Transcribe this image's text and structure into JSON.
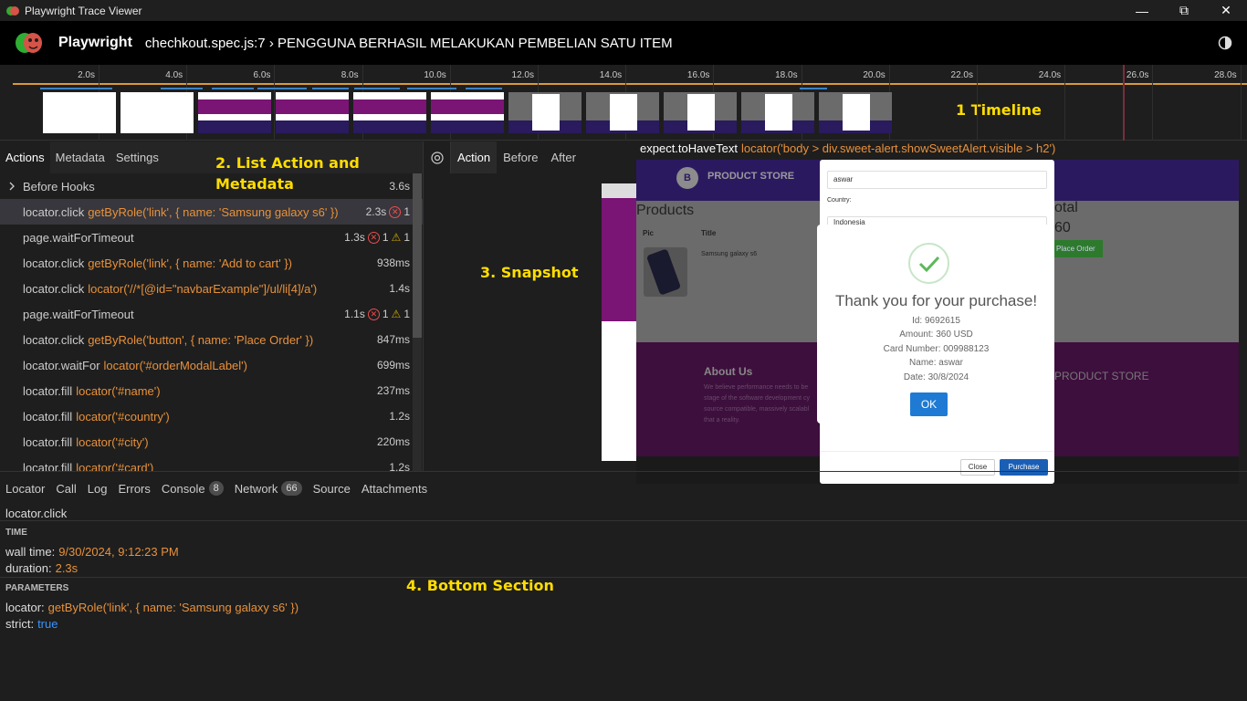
{
  "window": {
    "title": "Playwright Trace Viewer"
  },
  "header": {
    "brand": "Playwright",
    "path": "chechkout.spec.js:7 › PENGGUNA BERHASIL MELAKUKAN PEMBELIAN SATU ITEM"
  },
  "timeline": {
    "ticks": [
      "2.0s",
      "4.0s",
      "6.0s",
      "8.0s",
      "10.0s",
      "12.0s",
      "14.0s",
      "16.0s",
      "18.0s",
      "20.0s",
      "22.0s",
      "24.0s",
      "26.0s",
      "28.0s"
    ]
  },
  "annotations": {
    "timeline": "1 Timeline",
    "list": "2. List Action and Metadata",
    "snapshot": "3. Snapshot",
    "bottom": "4. Bottom Section"
  },
  "left_tabs": [
    "Actions",
    "Metadata",
    "Settings"
  ],
  "actions": [
    {
      "method": "Before Hooks",
      "selector": "",
      "duration": "3.6s",
      "errors": "",
      "warnings": ""
    },
    {
      "method": "locator.click",
      "selector": "getByRole('link', { name: 'Samsung galaxy s6' })",
      "duration": "2.3s",
      "errors": "1",
      "warnings": ""
    },
    {
      "method": "page.waitForTimeout",
      "selector": "",
      "duration": "1.3s",
      "errors": "1",
      "warnings": "1"
    },
    {
      "method": "locator.click",
      "selector": "getByRole('link', { name: 'Add to cart' })",
      "duration": "938ms",
      "errors": "",
      "warnings": ""
    },
    {
      "method": "locator.click",
      "selector": "locator('//*[@id=\"navbarExample\"]/ul/li[4]/a')",
      "duration": "1.4s",
      "errors": "",
      "warnings": ""
    },
    {
      "method": "page.waitForTimeout",
      "selector": "",
      "duration": "1.1s",
      "errors": "1",
      "warnings": "1"
    },
    {
      "method": "locator.click",
      "selector": "getByRole('button', { name: 'Place Order' })",
      "duration": "847ms",
      "errors": "",
      "warnings": ""
    },
    {
      "method": "locator.waitFor",
      "selector": "locator('#orderModalLabel')",
      "duration": "699ms",
      "errors": "",
      "warnings": ""
    },
    {
      "method": "locator.fill",
      "selector": "locator('#name')",
      "duration": "237ms",
      "errors": "",
      "warnings": ""
    },
    {
      "method": "locator.fill",
      "selector": "locator('#country')",
      "duration": "1.2s",
      "errors": "",
      "warnings": ""
    },
    {
      "method": "locator.fill",
      "selector": "locator('#city')",
      "duration": "220ms",
      "errors": "",
      "warnings": ""
    },
    {
      "method": "locator.fill",
      "selector": "locator('#card')",
      "duration": "1.2s",
      "errors": "",
      "warnings": ""
    }
  ],
  "snapshot_tabs": [
    "Action",
    "Before",
    "After"
  ],
  "expect": {
    "method": "expect.toHaveText",
    "selector": "locator('body > div.sweet-alert.showSweetAlert.visible > h2')"
  },
  "site": {
    "store": "PRODUCT STORE",
    "logo": "B",
    "products": "Products",
    "col_pic": "Pic",
    "col_title": "Title",
    "product_name": "Samsung galaxy s6",
    "total_label": "otal",
    "total_value": "60",
    "place_order": "Place Order",
    "about_title": "About Us",
    "about_text": "We believe performance needs to be stage of the software development cy source compatible, massively scalabl that a reality.",
    "footer_store": "PRODUCT STORE"
  },
  "order_modal": {
    "name_value": "aswar",
    "country_label": "Country:",
    "country_value": "Indonesia",
    "close": "Close",
    "purchase": "Purchase"
  },
  "sweet_alert": {
    "title": "Thank you for your purchase!",
    "id": "Id: 9692615",
    "amount": "Amount: 360 USD",
    "card": "Card Number: 009988123",
    "name": "Name: aswar",
    "date": "Date: 30/8/2024",
    "ok": "OK"
  },
  "bottom_tabs": [
    {
      "label": "Locator",
      "badge": ""
    },
    {
      "label": "Call",
      "badge": ""
    },
    {
      "label": "Log",
      "badge": ""
    },
    {
      "label": "Errors",
      "badge": ""
    },
    {
      "label": "Console",
      "badge": "8"
    },
    {
      "label": "Network",
      "badge": "66"
    },
    {
      "label": "Source",
      "badge": ""
    },
    {
      "label": "Attachments",
      "badge": ""
    }
  ],
  "call": {
    "title": "locator.click",
    "time_section": "TIME",
    "wall_label": "wall time:",
    "wall_value": "9/30/2024, 9:12:23 PM",
    "duration_label": "duration:",
    "duration_value": "2.3s",
    "params_section": "PARAMETERS",
    "locator_label": "locator:",
    "locator_value": "getByRole('link', { name: 'Samsung galaxy s6' })",
    "strict_label": "strict:",
    "strict_value": "true"
  },
  "colors": {
    "accent_orange": "#e8913a",
    "link_blue": "#3794ff",
    "annotation_yellow": "#ffdd00",
    "error_red": "#f14c4c"
  }
}
